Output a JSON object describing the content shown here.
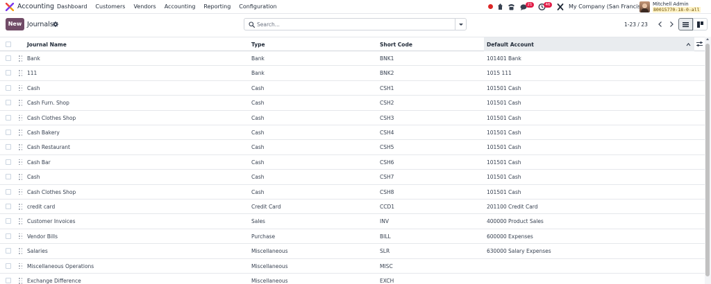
{
  "app": {
    "name": "Accounting"
  },
  "menu": [
    "Dashboard",
    "Customers",
    "Vendors",
    "Accounting",
    "Reporting",
    "Configuration"
  ],
  "systray": {
    "messages_count": "21",
    "activities_count": "46"
  },
  "company": "My Company (San Francisco)",
  "user": {
    "name": "Mitchell Admin",
    "database": "80015770-18-0-all"
  },
  "control_panel": {
    "new_label": "New",
    "title": "Journals"
  },
  "search": {
    "placeholder": "Search..."
  },
  "pager": {
    "value": "1-23 / 23"
  },
  "colors": {
    "brand": "#714b67",
    "badge": "#e11d48"
  },
  "table": {
    "columns": [
      "Journal Name",
      "Type",
      "Short Code",
      "Default Account"
    ],
    "sorted_column": "Default Account",
    "rows": [
      {
        "name": "Bank",
        "type": "Bank",
        "code": "BNK1",
        "account": "101401 Bank"
      },
      {
        "name": "111",
        "type": "Bank",
        "code": "BNK2",
        "account": "1015 111"
      },
      {
        "name": "Cash",
        "type": "Cash",
        "code": "CSH1",
        "account": "101501 Cash"
      },
      {
        "name": "Cash Furn. Shop",
        "type": "Cash",
        "code": "CSH2",
        "account": "101501 Cash"
      },
      {
        "name": "Cash Clothes Shop",
        "type": "Cash",
        "code": "CSH3",
        "account": "101501 Cash"
      },
      {
        "name": "Cash Bakery",
        "type": "Cash",
        "code": "CSH4",
        "account": "101501 Cash"
      },
      {
        "name": "Cash Restaurant",
        "type": "Cash",
        "code": "CSH5",
        "account": "101501 Cash"
      },
      {
        "name": "Cash Bar",
        "type": "Cash",
        "code": "CSH6",
        "account": "101501 Cash"
      },
      {
        "name": "Cash",
        "type": "Cash",
        "code": "CSH7",
        "account": "101501 Cash"
      },
      {
        "name": "Cash Clothes Shop",
        "type": "Cash",
        "code": "CSH8",
        "account": "101501 Cash"
      },
      {
        "name": "credit card",
        "type": "Credit Card",
        "code": "CCD1",
        "account": "201100 Credit Card"
      },
      {
        "name": "Customer Invoices",
        "type": "Sales",
        "code": "INV",
        "account": "400000 Product Sales"
      },
      {
        "name": "Vendor Bills",
        "type": "Purchase",
        "code": "BILL",
        "account": "600000 Expenses"
      },
      {
        "name": "Salaries",
        "type": "Miscellaneous",
        "code": "SLR",
        "account": "630000 Salary Expenses"
      },
      {
        "name": "Miscellaneous Operations",
        "type": "Miscellaneous",
        "code": "MISC",
        "account": ""
      },
      {
        "name": "Exchange Difference",
        "type": "Miscellaneous",
        "code": "EXCH",
        "account": ""
      }
    ]
  }
}
